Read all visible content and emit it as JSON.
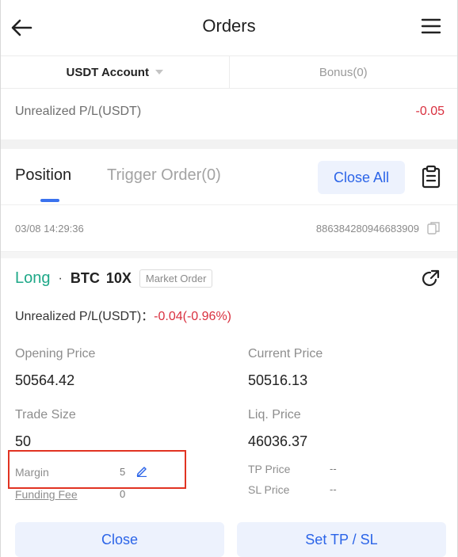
{
  "header": {
    "title": "Orders",
    "back_icon": "arrow-left-icon",
    "menu_icon": "hamburger-menu-icon"
  },
  "account_tabs": [
    {
      "label": "USDT Account",
      "active": true
    },
    {
      "label": "Bonus(0)",
      "active": false
    }
  ],
  "unrealized": {
    "label": "Unrealized P/L(USDT)",
    "value": "-0.05"
  },
  "position_tabs": {
    "active": "Position",
    "inactive": "Trigger Order(0)",
    "close_all": "Close All"
  },
  "order_meta": {
    "date": "03/08 14:29:36",
    "order_id": "886384280946683909"
  },
  "position": {
    "side": "Long",
    "symbol": "BTC",
    "leverage": "10X",
    "order_type": "Market Order",
    "upl_label": "Unrealized P/L(USDT)：",
    "upl_value": "-0.04(-0.96%)",
    "opening_price_label": "Opening Price",
    "opening_price": "50564.42",
    "current_price_label": "Current Price",
    "current_price": "50516.13",
    "trade_size_label": "Trade Size",
    "trade_size": "50",
    "liq_price_label": "Liq. Price",
    "liq_price": "46036.37",
    "margin_label": "Margin",
    "margin": "5",
    "funding_fee_label": "Funding Fee",
    "funding_fee": "0",
    "tp_label": "TP Price",
    "tp_value": "--",
    "sl_label": "SL Price",
    "sl_value": "--"
  },
  "actions": {
    "close": "Close",
    "set_tpsl": "Set TP / SL"
  },
  "colors": {
    "accent": "#2b64e8",
    "long": "#1ea888",
    "negative": "#d9303f",
    "highlight": "#e13322"
  }
}
